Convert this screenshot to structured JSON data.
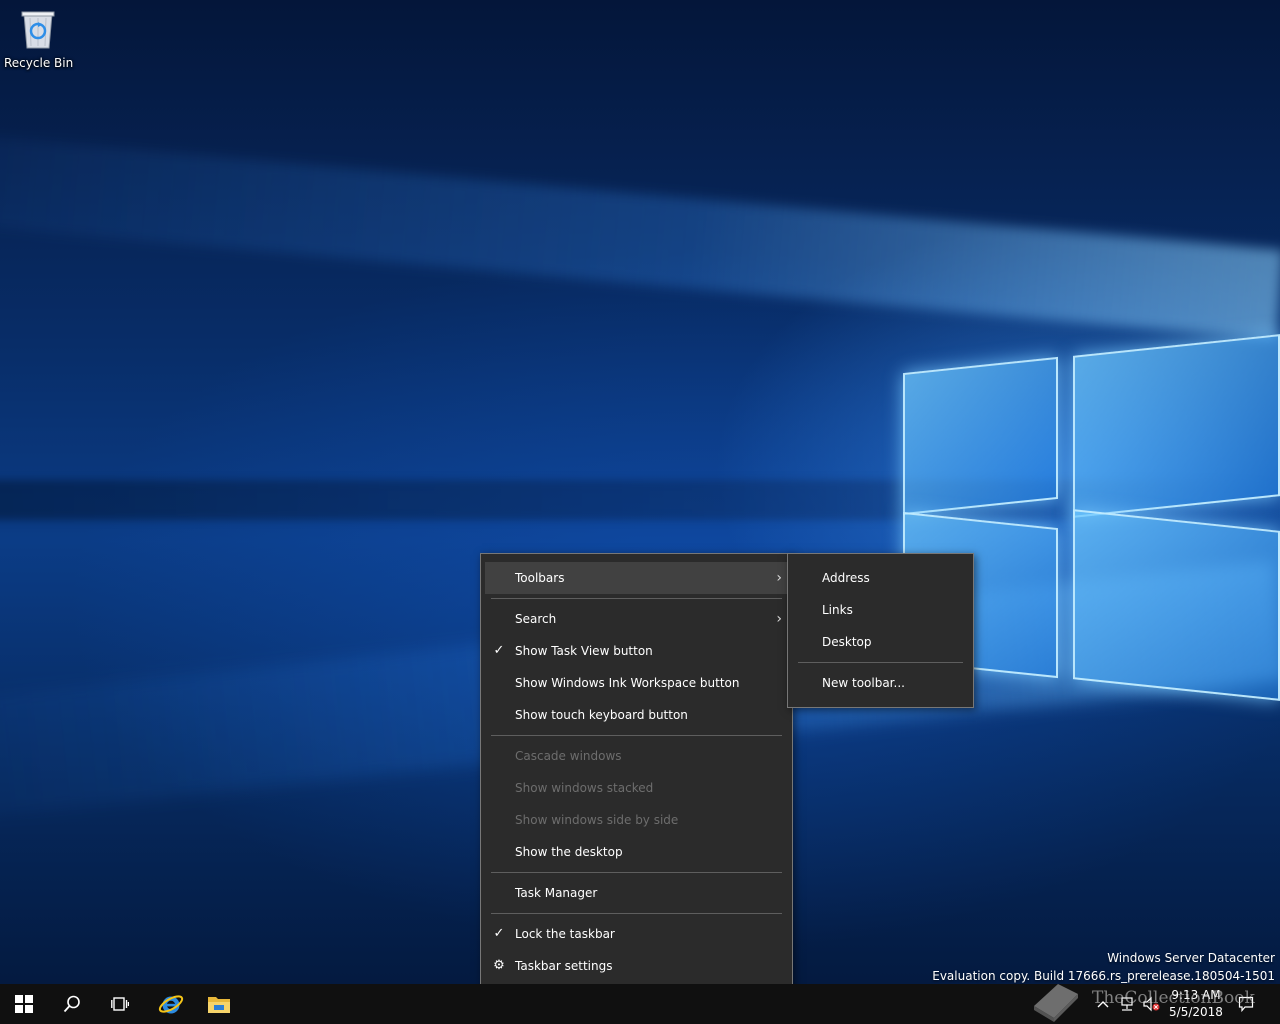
{
  "desktop": {
    "icons": [
      {
        "label": "Recycle Bin",
        "icon": "recycle-bin-icon"
      }
    ],
    "watermark": {
      "line1": "Windows Server Datacenter",
      "line2": "Evaluation copy. Build 17666.rs_prerelease.180504-1501"
    }
  },
  "context_menu": {
    "items": {
      "toolbars": "Toolbars",
      "search": "Search",
      "show_task_view": "Show Task View button",
      "show_ink_workspace": "Show Windows Ink Workspace button",
      "show_touch_keyboard": "Show touch keyboard button",
      "cascade_windows": "Cascade windows",
      "show_windows_stacked": "Show windows stacked",
      "show_side_by_side": "Show windows side by side",
      "show_desktop": "Show the desktop",
      "task_manager": "Task Manager",
      "lock_taskbar": "Lock the taskbar",
      "taskbar_settings": "Taskbar settings"
    },
    "checked": [
      "show_task_view",
      "lock_taskbar"
    ],
    "disabled": [
      "cascade_windows",
      "show_windows_stacked",
      "show_side_by_side"
    ],
    "glyphs": {
      "check": "✓",
      "arrow": "›",
      "gear": "⚙"
    }
  },
  "toolbars_submenu": {
    "items": {
      "address": "Address",
      "links": "Links",
      "desktop": "Desktop",
      "new_toolbar": "New toolbar..."
    }
  },
  "taskbar": {
    "buttons": [
      "start-icon",
      "search-icon",
      "task-view-icon",
      "internet-explorer-icon",
      "file-explorer-icon"
    ],
    "tray": {
      "clock_time": "9:13 AM",
      "clock_date": "5/5/2018"
    },
    "overlay_text": "TheCollectionBook"
  },
  "colors": {
    "menu_bg": "#2b2b2b",
    "menu_hover": "#414141",
    "disabled_text": "#6d6d6d",
    "taskbar_bg": "#101010"
  }
}
